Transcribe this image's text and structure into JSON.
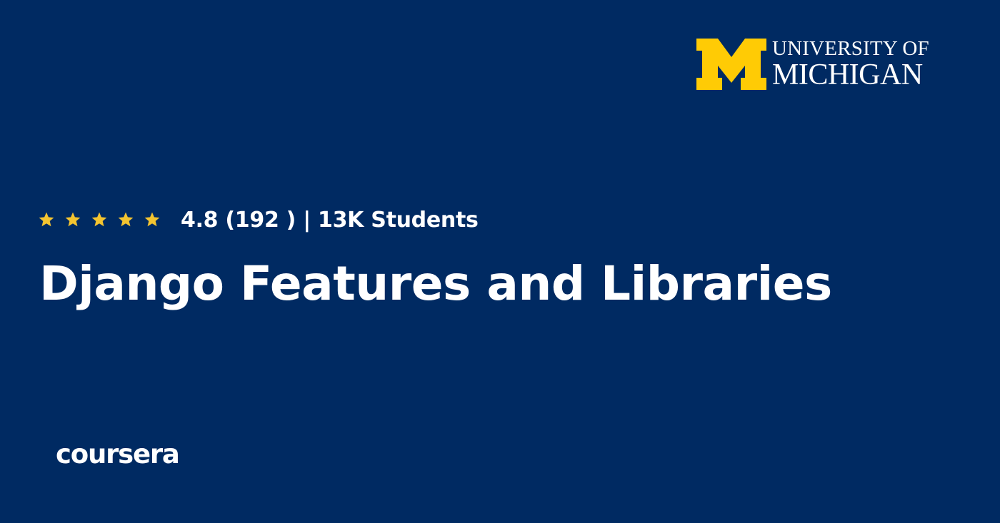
{
  "logo": {
    "icon": "block-m-logo",
    "line1": "UNIVERSITY OF",
    "line2": "MICHIGAN",
    "colors": {
      "maize": "#FFCB05",
      "blue": "#002A62"
    }
  },
  "rating": {
    "stars": 5,
    "star_icon": "star-icon",
    "star_color": "#F4C430",
    "text": "4.8 (192 ) | 13K Students"
  },
  "course": {
    "title": "Django Features and Libraries"
  },
  "brand": {
    "name": "coursera"
  }
}
